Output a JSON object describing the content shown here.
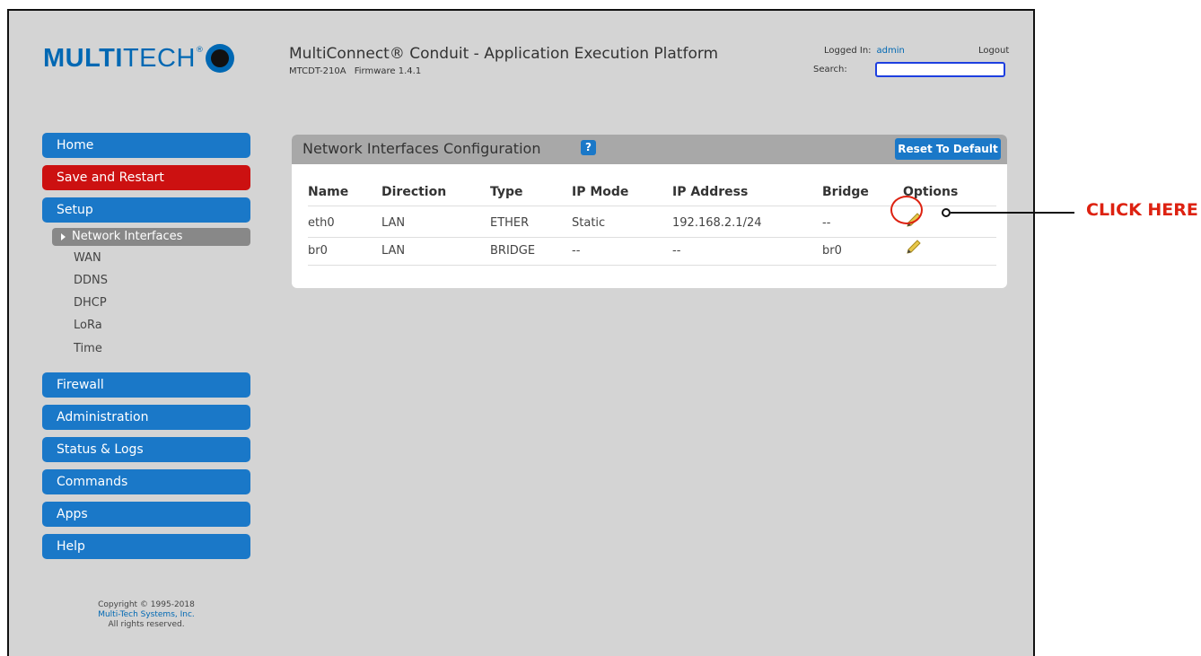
{
  "header": {
    "logo_bold": "MULTI",
    "logo_light": "TECH",
    "logo_reg": "®",
    "app_title": "MultiConnect® Conduit - Application Execution Platform",
    "model": "MTCDT-210A",
    "firmware": "Firmware 1.4.1",
    "logged_in_label": "Logged In:",
    "user": "admin",
    "logout": "Logout",
    "search_label": "Search:",
    "search_value": ""
  },
  "sidebar": {
    "home": "Home",
    "save_restart": "Save and Restart",
    "setup": "Setup",
    "setup_items": {
      "active": "Network Interfaces",
      "wan": "WAN",
      "ddns": "DDNS",
      "dhcp": "DHCP",
      "lora": "LoRa",
      "time": "Time"
    },
    "firewall": "Firewall",
    "administration": "Administration",
    "status_logs": "Status & Logs",
    "commands": "Commands",
    "apps": "Apps",
    "help": "Help"
  },
  "copyright": {
    "line1": "Copyright © 1995-2018",
    "line2": "Multi-Tech Systems, Inc.",
    "line3": "All rights reserved."
  },
  "panel": {
    "title": "Network Interfaces Configuration",
    "help": "?",
    "reset_button": "Reset To Default",
    "columns": {
      "name": "Name",
      "direction": "Direction",
      "type": "Type",
      "ip_mode": "IP Mode",
      "ip_address": "IP Address",
      "bridge": "Bridge",
      "options": "Options"
    },
    "rows": [
      {
        "name": "eth0",
        "direction": "LAN",
        "type": "ETHER",
        "ip_mode": "Static",
        "ip_address": "192.168.2.1/24",
        "bridge": "--"
      },
      {
        "name": "br0",
        "direction": "LAN",
        "type": "BRIDGE",
        "ip_mode": "--",
        "ip_address": "--",
        "bridge": "br0"
      }
    ]
  },
  "callout": {
    "text": "CLICK HERE",
    "color": "#dd2211"
  },
  "colors": {
    "nav_blue": "#1a78c8",
    "nav_red": "#cc1111",
    "background": "#d4d4d4"
  }
}
